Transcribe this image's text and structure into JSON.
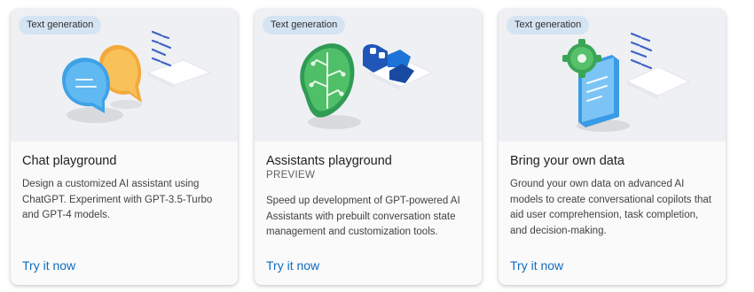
{
  "cards": [
    {
      "badge": "Text generation",
      "title": "Chat playground",
      "subtitle": "",
      "description": "Design a customized AI assistant using ChatGPT. Experiment with GPT-3.5-Turbo and GPT-4 models.",
      "link": "Try it now"
    },
    {
      "badge": "Text generation",
      "title": "Assistants playground",
      "subtitle": "PREVIEW",
      "description": "Speed up development of GPT-powered AI Assistants with prebuilt conversation state management and customization tools.",
      "link": "Try it now"
    },
    {
      "badge": "Text generation",
      "title": "Bring your own data",
      "subtitle": "",
      "description": "Ground your own data on advanced AI models to create conversational copilots that aid user comprehension, task completion, and decision-making.",
      "link": "Try it now"
    }
  ],
  "icons": [
    "chat-bubbles-illustration",
    "circuit-robot-illustration",
    "document-gear-illustration"
  ],
  "colors": {
    "link": "#0f6cbd",
    "badge_bg": "#d5e4f3",
    "hero_bg": "#eff0f3"
  }
}
